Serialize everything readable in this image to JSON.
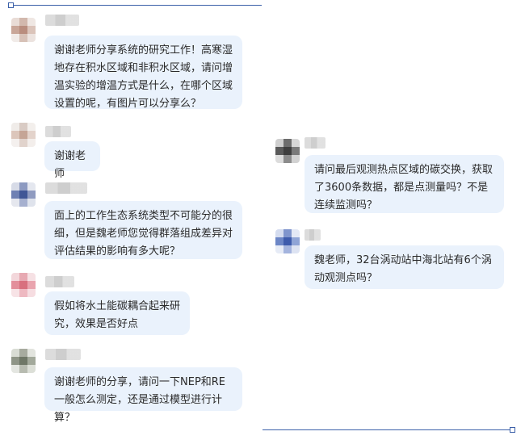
{
  "left_messages": [
    {
      "text": "谢谢老师分享系统的研究工作！高寒湿地存在积水区域和非积水区域，请问增温实验的增温方式是什么，在哪个区域设置的呢，有图片可以分享么？"
    },
    {
      "text": "谢谢老师"
    },
    {
      "text": "面上的工作生态系统类型不可能分的很细，但是魏老师您觉得群落组成差异对评估结果的影响有多大呢？"
    },
    {
      "text": "假如将水土能碳耦合起来研究，效果是否好点"
    },
    {
      "text": "谢谢老师的分享，请问一下NEP和RE一般怎么测定，还是通过模型进行计算？"
    }
  ],
  "right_messages": [
    {
      "text": "请问最后观测热点区域的碳交换，获取了3600条数据，都是点测量吗？不是连续监测吗？"
    },
    {
      "text": "魏老师，32台涡动站中海北站有6个涡动观测点吗？"
    }
  ],
  "colors": {
    "bubble_bg": "#eaf2fc",
    "divider": "#3a5fa8"
  }
}
